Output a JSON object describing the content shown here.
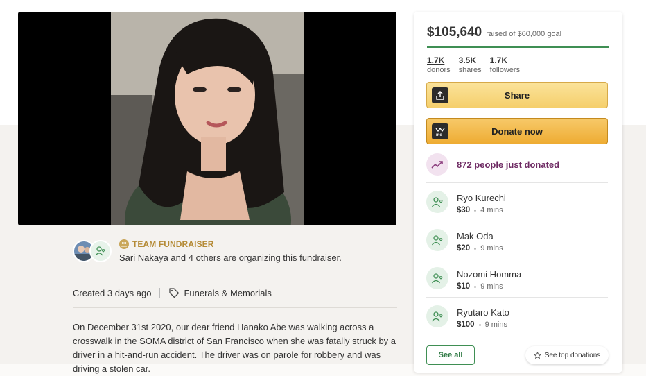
{
  "organizer": {
    "team_label": "TEAM FUNDRAISER",
    "text": "Sari Nakaya and 4 others are organizing this fundraiser."
  },
  "meta": {
    "created": "Created 3 days ago",
    "category": "Funerals & Memorials"
  },
  "story": {
    "part1": "On December 31st 2020, our dear friend Hanako Abe was walking across a crosswalk in the SOMA district of San Francisco when she was ",
    "link": "fatally struck",
    "part2": "  by a driver in a hit-and-run accident. The driver was on parole for robbery and was driving a stolen car."
  },
  "campaign": {
    "raised": "$105,640",
    "goal_text": "raised of $60,000 goal",
    "progress_fraction": 1.0,
    "stats": [
      {
        "num": "1.7K",
        "label": "donors"
      },
      {
        "num": "3.5K",
        "label": "shares"
      },
      {
        "num": "1.7K",
        "label": "followers"
      }
    ],
    "share_label": "Share",
    "donate_label": "Donate now",
    "trend_text": "872 people just donated",
    "donations": [
      {
        "name": "Ryo Kurechi",
        "amount": "$30",
        "time": "4 mins"
      },
      {
        "name": "Mak Oda",
        "amount": "$20",
        "time": "9 mins"
      },
      {
        "name": "Nozomi Homma",
        "amount": "$10",
        "time": "9 mins"
      },
      {
        "name": "Ryutaro Kato",
        "amount": "$100",
        "time": "9 mins"
      }
    ],
    "see_all_label": "See all",
    "see_top_label": "See top donations"
  },
  "colors": {
    "accent_green": "#3f8f54",
    "donate_orange": "#eeac33",
    "trend_purple": "#6e2a63",
    "team_gold": "#b58b36"
  }
}
